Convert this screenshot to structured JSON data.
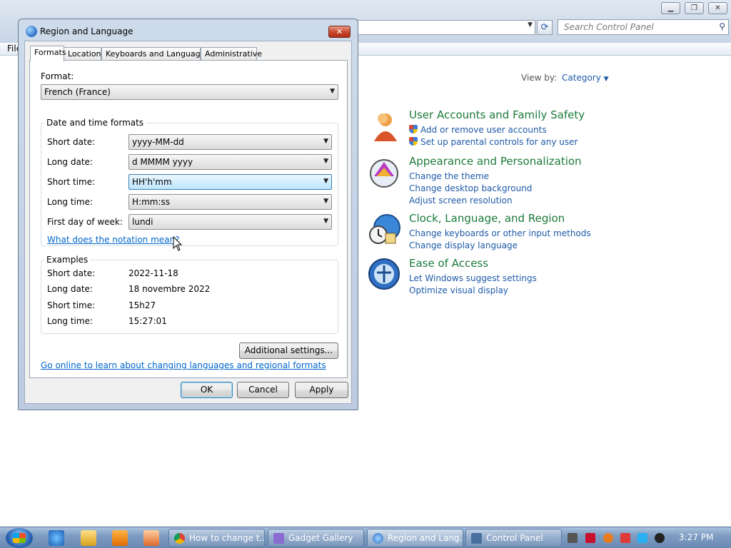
{
  "control_panel": {
    "menu_file": "File",
    "search_placeholder": "Search Control Panel",
    "view_by_label": "View by:",
    "view_by_value": "Category",
    "categories": [
      {
        "title": "User Accounts and Family Safety",
        "icon": "users-icon",
        "links": [
          "Add or remove user accounts",
          "Set up parental controls for any user"
        ]
      },
      {
        "title": "Appearance and Personalization",
        "icon": "appearance-icon",
        "links": [
          "Change the theme",
          "Change desktop background",
          "Adjust screen resolution"
        ]
      },
      {
        "title": "Clock, Language, and Region",
        "icon": "clock-globe-icon",
        "links": [
          "Change keyboards or other input methods",
          "Change display language"
        ]
      },
      {
        "title": "Ease of Access",
        "icon": "ease-of-access-icon",
        "links": [
          "Let Windows suggest settings",
          "Optimize visual display"
        ]
      }
    ]
  },
  "dialog": {
    "title": "Region and Language",
    "close_label": "✕",
    "tabs": [
      "Formats",
      "Location",
      "Keyboards and Languages",
      "Administrative"
    ],
    "format_label": "Format:",
    "format_value": "French (France)",
    "date_time_group": "Date and time formats",
    "short_date_label": "Short date:",
    "short_date_value": "yyyy-MM-dd",
    "long_date_label": "Long date:",
    "long_date_value": "d MMMM yyyy",
    "short_time_label": "Short time:",
    "short_time_value": "HH'h'mm",
    "long_time_label": "Long time:",
    "long_time_value": "H:mm:ss",
    "first_day_label": "First day of week:",
    "first_day_value": "lundi",
    "notation_link": "What does the notation mean?",
    "examples_group": "Examples",
    "examples": [
      {
        "label": "Short date:",
        "value": "2022-11-18"
      },
      {
        "label": "Long date:",
        "value": "18 novembre 2022"
      },
      {
        "label": "Short time:",
        "value": "15h27"
      },
      {
        "label": "Long time:",
        "value": "15:27:01"
      }
    ],
    "additional_settings": "Additional settings...",
    "online_link": "Go online to learn about changing languages and regional formats",
    "ok": "OK",
    "cancel": "Cancel",
    "apply": "Apply"
  },
  "taskbar": {
    "items": [
      {
        "label": "How to change t..."
      },
      {
        "label": "Gadget Gallery"
      },
      {
        "label": "Region and Lang..."
      },
      {
        "label": "Control Panel"
      }
    ],
    "clock": "3:27 PM"
  }
}
